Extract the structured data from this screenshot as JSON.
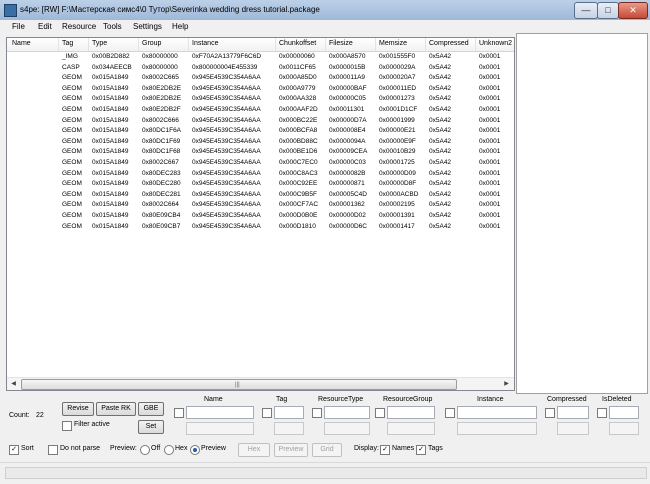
{
  "window": {
    "title": "s4pe: [RW] F:\\Мастерская симс4\\0 Тутор\\Severinka wedding dress tutorial.package",
    "minimize": "—",
    "maximize": "□",
    "close": "✕"
  },
  "menu": [
    "File",
    "Edit",
    "Resource",
    "Tools",
    "Settings",
    "Help"
  ],
  "columns": [
    "Name",
    "Tag",
    "Type",
    "Group",
    "Instance",
    "Chunkoffset",
    "Filesize",
    "Memsize",
    "Compressed",
    "Unknown2"
  ],
  "rows": [
    [
      "",
      "_IMG",
      "0x00B2D882",
      "0x80000000",
      "0xF70A2A13779F6C6D",
      "0x00000060",
      "0x000A8570",
      "0x001555F0",
      "0x5A42",
      "0x0001"
    ],
    [
      "",
      "CASP",
      "0x034AEECB",
      "0x80000000",
      "0x800000004E455339",
      "0x0011CF65",
      "0x0000015B",
      "0x0000029A",
      "0x5A42",
      "0x0001"
    ],
    [
      "",
      "GEOM",
      "0x015A1849",
      "0x8002C665",
      "0x945E4539C354A6AA",
      "0x000A85D0",
      "0x000011A9",
      "0x000020A7",
      "0x5A42",
      "0x0001"
    ],
    [
      "",
      "GEOM",
      "0x015A1849",
      "0x80E2DB2E",
      "0x945E4539C354A6AA",
      "0x000A9779",
      "0x00000BAF",
      "0x000011ED",
      "0x5A42",
      "0x0001"
    ],
    [
      "",
      "GEOM",
      "0x015A1849",
      "0x80E2DB2E",
      "0x945E4539C354A6AA",
      "0x000AA328",
      "0x00000C05",
      "0x00001273",
      "0x5A42",
      "0x0001"
    ],
    [
      "",
      "GEOM",
      "0x015A1849",
      "0x80E2DB2F",
      "0x945E4539C354A6AA",
      "0x000AAF2D",
      "0x00011301",
      "0x0001D1CF",
      "0x5A42",
      "0x0001"
    ],
    [
      "",
      "GEOM",
      "0x015A1849",
      "0x8002C666",
      "0x945E4539C354A6AA",
      "0x000BC22E",
      "0x00000D7A",
      "0x00001999",
      "0x5A42",
      "0x0001"
    ],
    [
      "",
      "GEOM",
      "0x015A1849",
      "0x80DC1F6A",
      "0x945E4539C354A6AA",
      "0x000BCFA8",
      "0x000008E4",
      "0x00000E21",
      "0x5A42",
      "0x0001"
    ],
    [
      "",
      "GEOM",
      "0x015A1849",
      "0x80DC1F69",
      "0x945E4539C354A6AA",
      "0x000BD88C",
      "0x0000094A",
      "0x00000E9F",
      "0x5A42",
      "0x0001"
    ],
    [
      "",
      "GEOM",
      "0x015A1849",
      "0x80DC1F68",
      "0x945E4539C354A6AA",
      "0x000BE1D6",
      "0x00009CEA",
      "0x00010B29",
      "0x5A42",
      "0x0001"
    ],
    [
      "",
      "GEOM",
      "0x015A1849",
      "0x8002C667",
      "0x945E4539C354A6AA",
      "0x000C7EC0",
      "0x00000C03",
      "0x00001725",
      "0x5A42",
      "0x0001"
    ],
    [
      "",
      "GEOM",
      "0x015A1849",
      "0x80DEC283",
      "0x945E4539C354A6AA",
      "0x000C8AC3",
      "0x0000082B",
      "0x00000D09",
      "0x5A42",
      "0x0001"
    ],
    [
      "",
      "GEOM",
      "0x015A1849",
      "0x80DEC280",
      "0x945E4539C354A6AA",
      "0x000C92EE",
      "0x00000871",
      "0x00000D8F",
      "0x5A42",
      "0x0001"
    ],
    [
      "",
      "GEOM",
      "0x015A1849",
      "0x80DEC281",
      "0x945E4539C354A6AA",
      "0x000C9B5F",
      "0x00005C4D",
      "0x0000ACBD",
      "0x5A42",
      "0x0001"
    ],
    [
      "",
      "GEOM",
      "0x015A1849",
      "0x8002C664",
      "0x945E4539C354A6AA",
      "0x000CF7AC",
      "0x00001362",
      "0x00002195",
      "0x5A42",
      "0x0001"
    ],
    [
      "",
      "GEOM",
      "0x015A1849",
      "0x80E09CB4",
      "0x945E4539C354A6AA",
      "0x000D0B0E",
      "0x00000D02",
      "0x00001391",
      "0x5A42",
      "0x0001"
    ],
    [
      "",
      "GEOM",
      "0x015A1849",
      "0x80E09CB7",
      "0x945E4539C354A6AA",
      "0x000D1810",
      "0x00000D6C",
      "0x00001417",
      "0x5A42",
      "0x0001"
    ]
  ],
  "scroll": {
    "left_arrow": "◀",
    "right_arrow": "▶",
    "grip": "|||"
  },
  "controls": {
    "count_label": "Count:",
    "count_value": "22",
    "revise": "Revise",
    "paste_rk": "Paste RK",
    "gbe": "GBE",
    "set": "Set",
    "filter_active": "Filter active",
    "sort": "Sort",
    "do_not_parse": "Do not parse",
    "preview_label": "Preview:",
    "preview_off": "Off",
    "preview_hex": "Hex",
    "preview_preview": "Preview",
    "hex_btn": "Hex",
    "preview_btn": "Preview",
    "grid_btn": "Grid",
    "display_label": "Display:",
    "names": "Names",
    "tags": "Tags",
    "check": "✓"
  },
  "filter_headers": [
    "Name",
    "Tag",
    "ResourceType",
    "ResourceGroup",
    "Instance",
    "Compressed",
    "IsDeleted"
  ]
}
